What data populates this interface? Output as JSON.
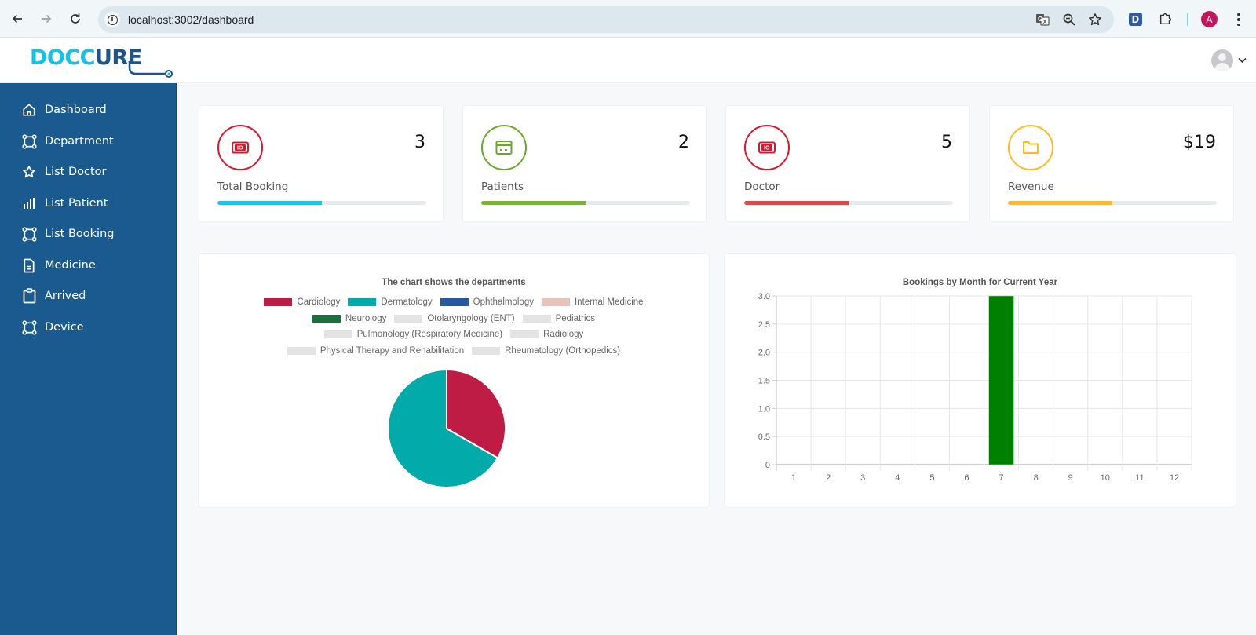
{
  "browser": {
    "url": "localhost:3002/dashboard",
    "profile_initial": "A",
    "extension_label": "D",
    "icons": [
      "back-icon",
      "forward-icon",
      "reload-icon",
      "site-info-icon",
      "translate-icon",
      "zoom-out-icon",
      "bookmark-star-icon",
      "extensions-puzzle-icon",
      "menu-kebab-icon"
    ]
  },
  "header": {
    "logo_part1": "DOCC",
    "logo_part2": "URE"
  },
  "sidebar": {
    "items": [
      {
        "label": "Dashboard",
        "icon": "home-icon"
      },
      {
        "label": "Department",
        "icon": "vector-square-icon"
      },
      {
        "label": "List Doctor",
        "icon": "star-icon"
      },
      {
        "label": "List Patient",
        "icon": "bar-chart-icon"
      },
      {
        "label": "List Booking",
        "icon": "vector-square-icon"
      },
      {
        "label": "Medicine",
        "icon": "document-icon"
      },
      {
        "label": "Arrived",
        "icon": "clipboard-icon"
      },
      {
        "label": "Device",
        "icon": "vector-square-icon"
      }
    ]
  },
  "stats": [
    {
      "label": "Total Booking",
      "value": "3",
      "icon": "money-bill-icon",
      "color": "#e0142b",
      "bar_color": "#14c8ec",
      "progress": 0.5
    },
    {
      "label": "Patients",
      "value": "2",
      "icon": "credit-card-icon",
      "color": "#6aa829",
      "bar_color": "#77b234",
      "progress": 0.5
    },
    {
      "label": "Doctor",
      "value": "5",
      "icon": "money-bill-icon",
      "color": "#e0142b",
      "bar_color": "#e84549",
      "progress": 0.5
    },
    {
      "label": "Revenue",
      "value": "$19",
      "icon": "folder-icon",
      "color": "#fcbb1e",
      "bar_color": "#fdb92e",
      "progress": 0.5
    }
  ],
  "chart_data": [
    {
      "type": "pie",
      "title": "The chart shows the departments",
      "legend_position": "top",
      "categories": [
        "Cardiology",
        "Dermatology",
        "Ophthalmology",
        "Internal Medicine",
        "Neurology",
        "Otolaryngology (ENT)",
        "Pediatrics",
        "Pulmonology (Respiratory Medicine)",
        "Radiology",
        "Physical Therapy and Rehabilitation",
        "Rheumatology (Orthopedics)"
      ],
      "values": [
        1,
        2,
        0,
        0,
        0,
        0,
        0,
        0,
        0,
        0,
        0
      ],
      "colors": [
        "#be1b45",
        "#03aaaa",
        "#26599e",
        "#e7c3b8",
        "#1d6f3e",
        "#e3e3e3",
        "#e3e3e3",
        "#e3e3e3",
        "#e3e3e3",
        "#e3e3e3",
        "#e3e3e3"
      ],
      "legend_rows": [
        [
          0,
          1,
          2,
          3
        ],
        [
          4,
          5,
          6
        ],
        [
          7,
          8
        ],
        [
          9,
          10
        ]
      ]
    },
    {
      "type": "bar",
      "title": "Bookings by Month for Current Year",
      "categories": [
        "1",
        "2",
        "3",
        "4",
        "5",
        "6",
        "7",
        "8",
        "9",
        "10",
        "11",
        "12"
      ],
      "values": [
        0,
        0,
        0,
        0,
        0,
        0,
        3,
        0,
        0,
        0,
        0,
        0
      ],
      "ylim": [
        0,
        3
      ],
      "yticks": [
        "0",
        "0.5",
        "1.0",
        "1.5",
        "2.0",
        "2.5",
        "3.0"
      ],
      "grid": true,
      "bar_color": "#008000",
      "xlabel": "",
      "ylabel": ""
    }
  ]
}
